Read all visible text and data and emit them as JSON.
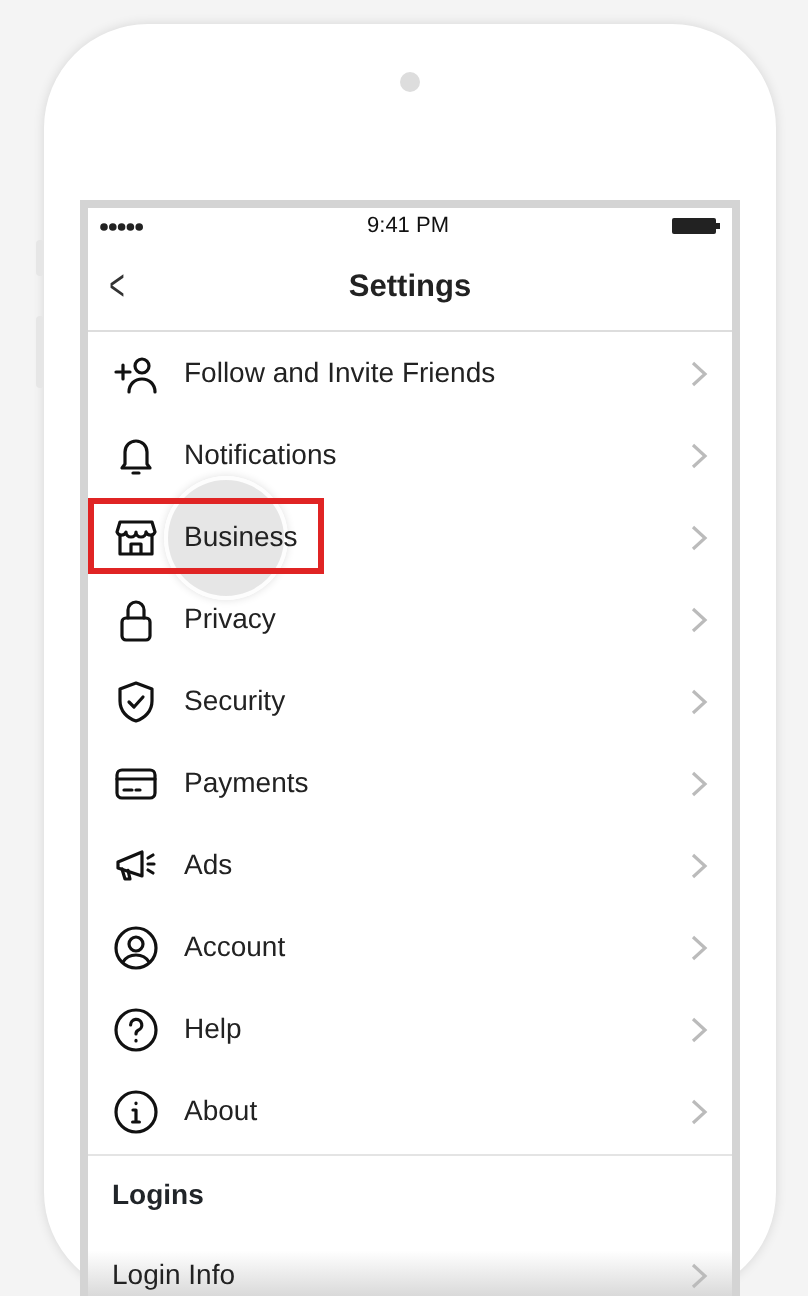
{
  "status_bar": {
    "time": "9:41 PM"
  },
  "nav": {
    "back": "<",
    "title": "Settings"
  },
  "items": [
    {
      "kind": "item",
      "label": "Follow and Invite Friends",
      "highlighted": false
    },
    {
      "kind": "item",
      "label": "Notifications",
      "highlighted": false
    },
    {
      "kind": "item",
      "label": "Business",
      "highlighted": true
    },
    {
      "kind": "item",
      "label": "Privacy",
      "highlighted": false
    },
    {
      "kind": "item",
      "label": "Security",
      "highlighted": false
    },
    {
      "kind": "item",
      "label": "Payments",
      "highlighted": false
    },
    {
      "kind": "item",
      "label": "Ads",
      "highlighted": false
    },
    {
      "kind": "item",
      "label": "Account",
      "highlighted": false
    },
    {
      "kind": "item",
      "label": "Help",
      "highlighted": false
    },
    {
      "kind": "item",
      "label": "About",
      "highlighted": false
    },
    {
      "kind": "header",
      "label": "Logins"
    },
    {
      "kind": "item",
      "label": "Login Info",
      "highlighted": false
    }
  ]
}
